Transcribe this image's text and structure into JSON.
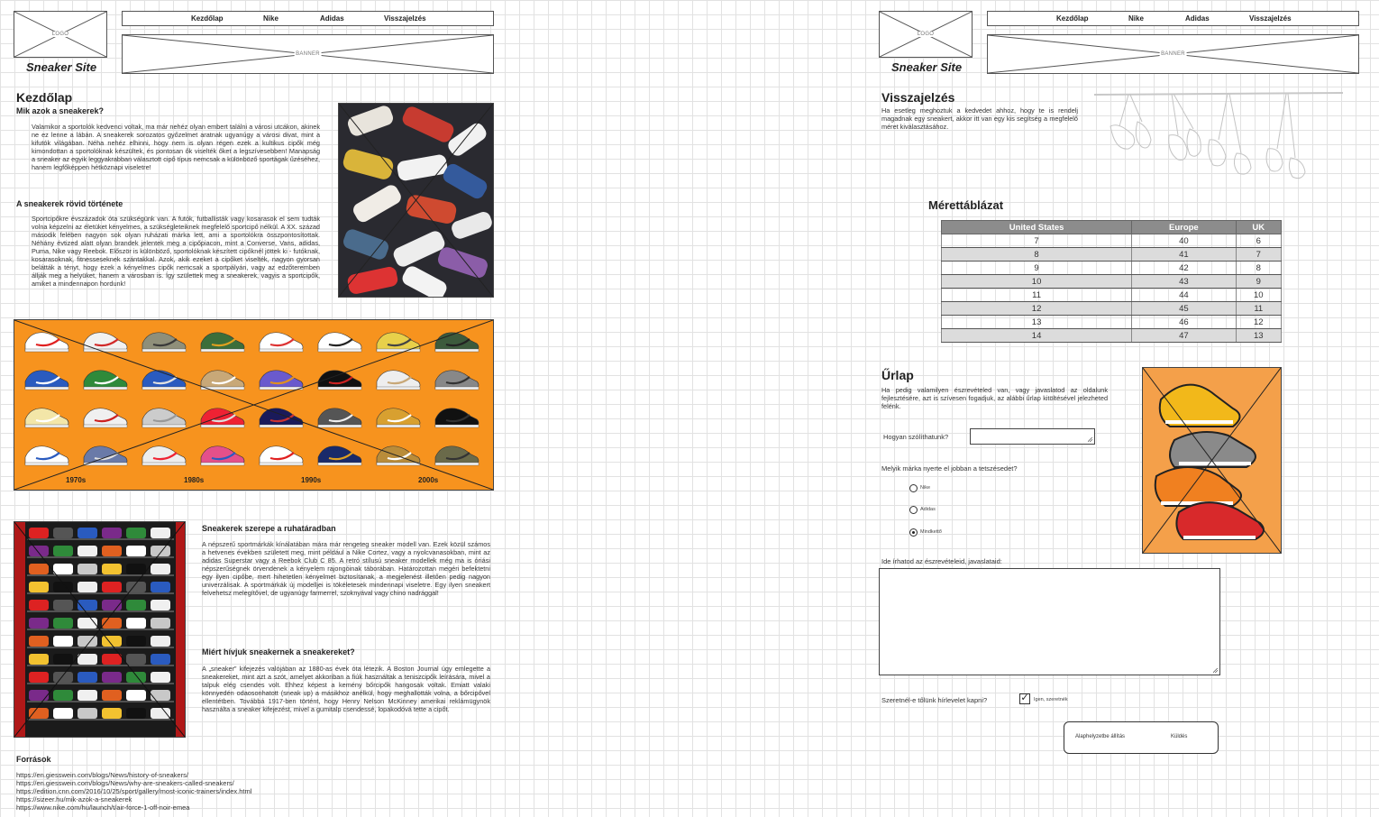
{
  "site": {
    "logo_label": "LOGO",
    "title": "Sneaker Site",
    "banner_label": "BANNER"
  },
  "nav": {
    "home": "Kezdőlap",
    "nike": "Nike",
    "adidas": "Adidas",
    "feedback": "Visszajelzés"
  },
  "home": {
    "heading": "Kezdőlap",
    "q1": "Mik azok a sneakerek?",
    "p1": "Valamikor a sportolók kedvenci voltak, ma már nehéz olyan embert találni a városi utcákon, akinek ne ez lenne a lábán. A sneakerek sorozatos győzelmet aratnak ugyanúgy a városi divat, mint a kifutók világában. Néha nehéz elhinni, hogy nem is olyan régen ezek a kultikus cipők még kimondottan a sportolóknak készültek, és pontosan ők viselték őket a legszívesebben! Manapság a sneaker az egyik leggyakrabban választott cipő típus nemcsak a különböző sportágak űzéséhez, hanem legfőképpen hétköznapi viseletre!",
    "q2": "A sneakerek rövid története",
    "p2": "Sportcipőkre évszázadok óta szükségünk van. A futók, futballisták vagy kosarasok el sem tudták volna képzelni az életüket kényelmes, a szükségleteiknek megfelelő sportcipő nélkül. A XX. század második felében nagyon sok olyan ruházati márka lett, ami a sportolókra összpontosítottak. Néhány évtized alatt olyan brandek jelentek meg a cipőpiacon, mint a Converse, Vans, adidas, Puma, Nike vagy Reebok. Először is különböző, sportolóknak készített cipőknél jöttek ki - futóknak, kosarasoknak, fitnesseseknek szántakkal. Azok, akik ezeket a cipőket viselték, nagyon gyorsan belátták a tényt, hogy ezek a kényelmes cipők nemcsak a sportpályán, vagy az edzőteremben állják meg a helyüket, hanem a városban is. Így születtek meg a sneakerek, vagyis a sportcipők, amiket a mindennapon hordunk!",
    "decades": [
      "1970s",
      "1980s",
      "1990s",
      "2000s"
    ],
    "q3": "Sneakerek szerepe a ruhatáradban",
    "p3": "A népszerű sportmárkák kínálatában mára már rengeteg sneaker modell van. Ezek közül számos a hetvenes években született meg, mint például a Nike Cortez, vagy a nyolcvanasokban, mint az adidas Superstar vagy a Reebok Club C 85. A retró stílusú sneaker modellek még ma is óriási népszerűségnek örvendenek a kényelem rajongóinak táborában. Határozottan megéri befektetni egy ilyen cipőbe, mert hihetetlen kényelmet biztosítanak, a megjelenést illetően pedig nagyon univerzálisak. A sportmárkák új modelljei is tökéletesek mindennapi viseletre. Egy ilyen sneakert felvehetsz melegítővel, de ugyanúgy farmerrel, szoknyával vagy chino nadrággal!",
    "q4": "Miért hívjuk sneakernek a sneakereket?",
    "p4": "A „sneaker” kifejezés valójában az 1880-as évek óta létezik. A Boston Journal úgy emlegette a sneakereket, mint azt a szót, amelyet akkoriban a fiúk használtak a teniszcipők leírására, mivel a talpuk elég csendes volt. Ehhez képest a kemény bőrcipők hangosak voltak. Emiatt valaki könnyedén odaosonhatott (sneak up) a másikhoz anélkül, hogy meghallották volna, a bőrcipővel ellentétben. Továbbá 1917-ben történt, hogy Henry Nelson McKinney amerikai reklámügynök használta a sneaker kifejezést, mivel a gumitalp csendessé, lopakodóvá tette a cipőt.",
    "sources_heading": "Források",
    "sources": [
      "https://en.giesswein.com/blogs/News/history-of-sneakers/",
      "https://en.giesswein.com/blogs/News/why-are-sneakers-called-sneakers/",
      "https://edition.cnn.com/2016/10/25/sport/gallery/most-iconic-trainers/index.html",
      "https://sizeer.hu/mik-azok-a-sneakerek",
      "https://www.nike.com/hu/launch/t/air-force-1-off-noir-emea"
    ]
  },
  "feedback": {
    "heading": "Visszajelzés",
    "intro": "Ha esetleg meghoztuk a kedvedet ahhoz, hogy te is rendelj magadnak egy sneakert, akkor itt van egy kis segítség a megfelelő méret kiválasztásához.",
    "size_heading": "Mérettáblázat",
    "size_headers": [
      "United States",
      "Europe",
      "UK"
    ],
    "size_rows": [
      [
        "7",
        "40",
        "6"
      ],
      [
        "8",
        "41",
        "7"
      ],
      [
        "9",
        "42",
        "8"
      ],
      [
        "10",
        "43",
        "9"
      ],
      [
        "11",
        "44",
        "10"
      ],
      [
        "12",
        "45",
        "11"
      ],
      [
        "13",
        "46",
        "12"
      ],
      [
        "14",
        "47",
        "13"
      ]
    ],
    "form_heading": "Űrlap",
    "form_intro": "Ha pedig valamilyen észrevételed van, vagy javaslatod az oldalunk fejlesztésére, azt is szívesen fogadjuk, az alábbi űrlap kitöltésével jelezheted felénk.",
    "name_label": "Hogyan szólíthatunk?",
    "name_value": "",
    "brand_question": "Melyik márka nyerte el jobban a tetszésedet?",
    "brand_options": [
      "Nike",
      "Adidas",
      "Mindkettő"
    ],
    "brand_selected": "Mindkettő",
    "comments_label": "Ide írhatod az észrevételeid, javaslataid:",
    "comments_value": "",
    "newsletter_label": "Szeretnél-e tőlünk hírlevelet kapni?",
    "newsletter_option": "Igen, szeretnék",
    "newsletter_checked": true,
    "reset_label": "Alaphelyzetbe állítás",
    "submit_label": "Küldés"
  },
  "colors": {
    "orange": "#f7931e",
    "header_gray": "#8c8c8c",
    "row_gray": "#dcdcdc"
  }
}
